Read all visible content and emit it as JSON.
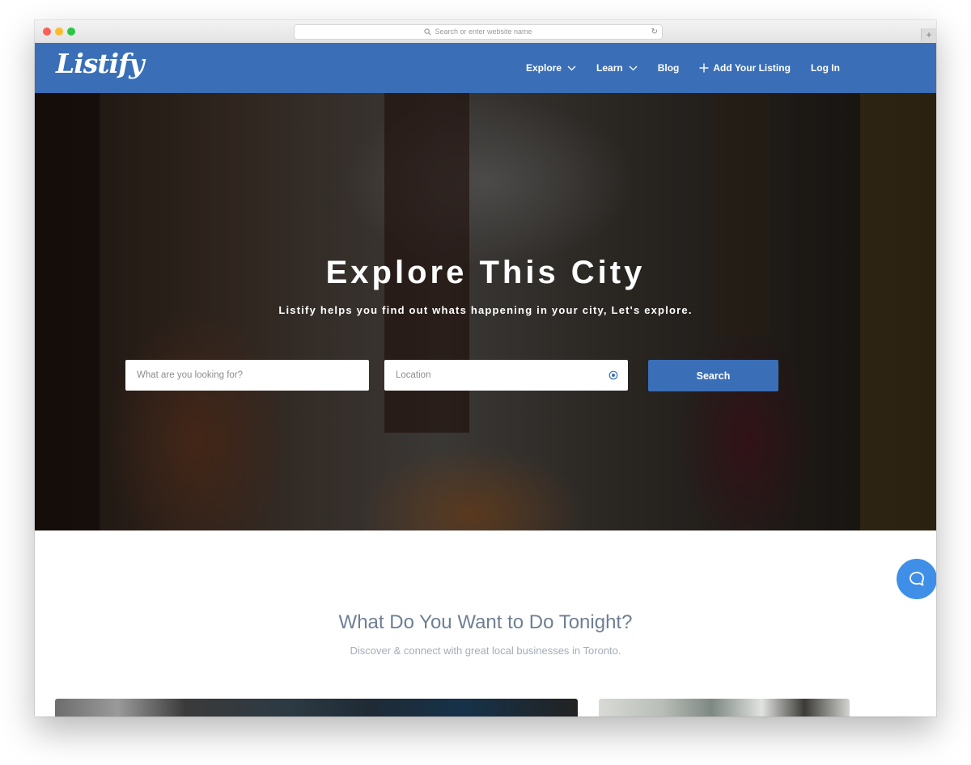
{
  "browser": {
    "url_placeholder": "Search or enter website name",
    "reload_icon": "reload-icon",
    "new_tab_label": "+"
  },
  "site": {
    "logo": "Listify",
    "nav": {
      "explore": "Explore",
      "learn": "Learn",
      "blog": "Blog",
      "add_listing": "Add Your Listing",
      "login": "Log In"
    },
    "brand_color": "#3a6fb8"
  },
  "hero": {
    "title": "Explore This City",
    "subtitle": "Listify helps you find out whats happening in your city, Let's explore.",
    "what_placeholder": "What are you looking for?",
    "location_placeholder": "Location",
    "search_label": "Search"
  },
  "section": {
    "title": "What Do You Want to Do Tonight?",
    "subtitle": "Discover & connect with great local businesses in Toronto."
  },
  "chat": {
    "icon": "chat-bubble-icon",
    "color": "#3f8fe8"
  }
}
